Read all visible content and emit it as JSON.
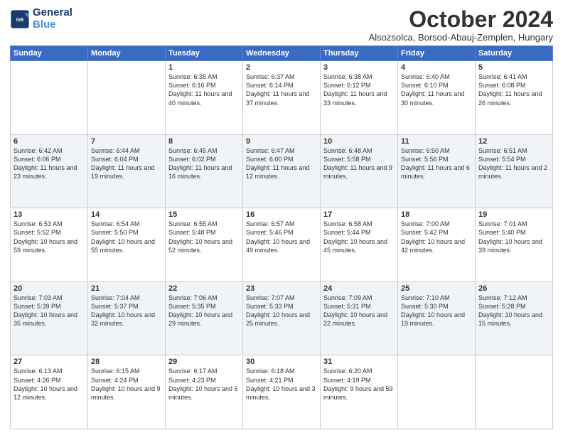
{
  "logo": {
    "line1": "General",
    "line2": "Blue"
  },
  "title": "October 2024",
  "location": "Alsozsolca, Borsod-Abauj-Zemplen, Hungary",
  "days_of_week": [
    "Sunday",
    "Monday",
    "Tuesday",
    "Wednesday",
    "Thursday",
    "Friday",
    "Saturday"
  ],
  "weeks": [
    [
      {
        "day": "",
        "content": ""
      },
      {
        "day": "",
        "content": ""
      },
      {
        "day": "1",
        "content": "Sunrise: 6:35 AM\nSunset: 6:16 PM\nDaylight: 11 hours and 40 minutes."
      },
      {
        "day": "2",
        "content": "Sunrise: 6:37 AM\nSunset: 6:14 PM\nDaylight: 11 hours and 37 minutes."
      },
      {
        "day": "3",
        "content": "Sunrise: 6:38 AM\nSunset: 6:12 PM\nDaylight: 11 hours and 33 minutes."
      },
      {
        "day": "4",
        "content": "Sunrise: 6:40 AM\nSunset: 6:10 PM\nDaylight: 11 hours and 30 minutes."
      },
      {
        "day": "5",
        "content": "Sunrise: 6:41 AM\nSunset: 6:08 PM\nDaylight: 11 hours and 26 minutes."
      }
    ],
    [
      {
        "day": "6",
        "content": "Sunrise: 6:42 AM\nSunset: 6:06 PM\nDaylight: 11 hours and 23 minutes."
      },
      {
        "day": "7",
        "content": "Sunrise: 6:44 AM\nSunset: 6:04 PM\nDaylight: 11 hours and 19 minutes."
      },
      {
        "day": "8",
        "content": "Sunrise: 6:45 AM\nSunset: 6:02 PM\nDaylight: 11 hours and 16 minutes."
      },
      {
        "day": "9",
        "content": "Sunrise: 6:47 AM\nSunset: 6:00 PM\nDaylight: 11 hours and 12 minutes."
      },
      {
        "day": "10",
        "content": "Sunrise: 6:48 AM\nSunset: 5:58 PM\nDaylight: 11 hours and 9 minutes."
      },
      {
        "day": "11",
        "content": "Sunrise: 6:50 AM\nSunset: 5:56 PM\nDaylight: 11 hours and 6 minutes."
      },
      {
        "day": "12",
        "content": "Sunrise: 6:51 AM\nSunset: 5:54 PM\nDaylight: 11 hours and 2 minutes."
      }
    ],
    [
      {
        "day": "13",
        "content": "Sunrise: 6:53 AM\nSunset: 5:52 PM\nDaylight: 10 hours and 59 minutes."
      },
      {
        "day": "14",
        "content": "Sunrise: 6:54 AM\nSunset: 5:50 PM\nDaylight: 10 hours and 55 minutes."
      },
      {
        "day": "15",
        "content": "Sunrise: 6:55 AM\nSunset: 5:48 PM\nDaylight: 10 hours and 52 minutes."
      },
      {
        "day": "16",
        "content": "Sunrise: 6:57 AM\nSunset: 5:46 PM\nDaylight: 10 hours and 49 minutes."
      },
      {
        "day": "17",
        "content": "Sunrise: 6:58 AM\nSunset: 5:44 PM\nDaylight: 10 hours and 45 minutes."
      },
      {
        "day": "18",
        "content": "Sunrise: 7:00 AM\nSunset: 5:42 PM\nDaylight: 10 hours and 42 minutes."
      },
      {
        "day": "19",
        "content": "Sunrise: 7:01 AM\nSunset: 5:40 PM\nDaylight: 10 hours and 39 minutes."
      }
    ],
    [
      {
        "day": "20",
        "content": "Sunrise: 7:03 AM\nSunset: 5:39 PM\nDaylight: 10 hours and 35 minutes."
      },
      {
        "day": "21",
        "content": "Sunrise: 7:04 AM\nSunset: 5:37 PM\nDaylight: 10 hours and 32 minutes."
      },
      {
        "day": "22",
        "content": "Sunrise: 7:06 AM\nSunset: 5:35 PM\nDaylight: 10 hours and 29 minutes."
      },
      {
        "day": "23",
        "content": "Sunrise: 7:07 AM\nSunset: 5:33 PM\nDaylight: 10 hours and 25 minutes."
      },
      {
        "day": "24",
        "content": "Sunrise: 7:09 AM\nSunset: 5:31 PM\nDaylight: 10 hours and 22 minutes."
      },
      {
        "day": "25",
        "content": "Sunrise: 7:10 AM\nSunset: 5:30 PM\nDaylight: 10 hours and 19 minutes."
      },
      {
        "day": "26",
        "content": "Sunrise: 7:12 AM\nSunset: 5:28 PM\nDaylight: 10 hours and 15 minutes."
      }
    ],
    [
      {
        "day": "27",
        "content": "Sunrise: 6:13 AM\nSunset: 4:26 PM\nDaylight: 10 hours and 12 minutes."
      },
      {
        "day": "28",
        "content": "Sunrise: 6:15 AM\nSunset: 4:24 PM\nDaylight: 10 hours and 9 minutes."
      },
      {
        "day": "29",
        "content": "Sunrise: 6:17 AM\nSunset: 4:23 PM\nDaylight: 10 hours and 6 minutes."
      },
      {
        "day": "30",
        "content": "Sunrise: 6:18 AM\nSunset: 4:21 PM\nDaylight: 10 hours and 3 minutes."
      },
      {
        "day": "31",
        "content": "Sunrise: 6:20 AM\nSunset: 4:19 PM\nDaylight: 9 hours and 59 minutes."
      },
      {
        "day": "",
        "content": ""
      },
      {
        "day": "",
        "content": ""
      }
    ]
  ]
}
